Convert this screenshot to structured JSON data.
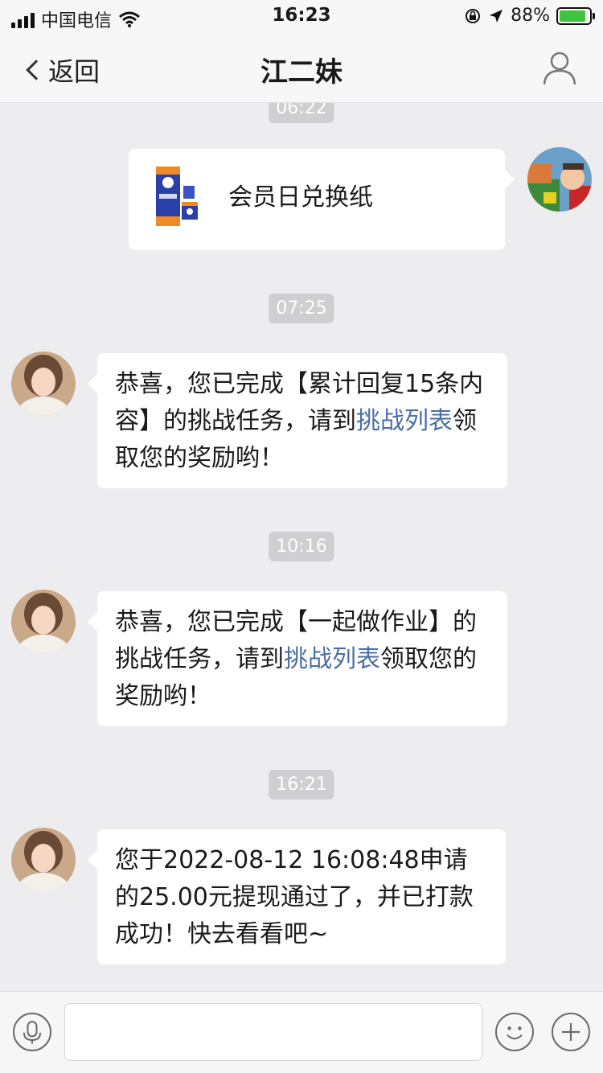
{
  "status_bar": {
    "carrier": "中国电信",
    "time": "16:23",
    "battery": "88%",
    "battery_level": 0.88
  },
  "nav": {
    "back_label": "返回",
    "title": "江二妹"
  },
  "messages": [
    {
      "timestamp": "06:22"
    },
    {
      "side": "right",
      "text": "会员日兑换纸"
    },
    {
      "timestamp": "07:25"
    },
    {
      "side": "left",
      "line1": "恭喜，您已完成【累计回复15条内容】的挑战任务，请到",
      "link": "挑战列表",
      "line2": "领取您的奖励哟！"
    },
    {
      "timestamp": "10:16"
    },
    {
      "side": "left",
      "line1": "恭喜，您已完成【一起做作业】的挑战任务，请到",
      "link": "挑战列表",
      "line2": "领取您的奖励哟！"
    },
    {
      "timestamp": "16:21"
    },
    {
      "side": "left",
      "text": "您于2022-08-12 16:08:48申请的25.00元提现通过了，并已打款成功！快去看看吧~"
    }
  ],
  "icons": {
    "voice": "microphone-icon",
    "emoji": "smiley-icon",
    "more": "plus-icon",
    "profile": "person-icon"
  }
}
